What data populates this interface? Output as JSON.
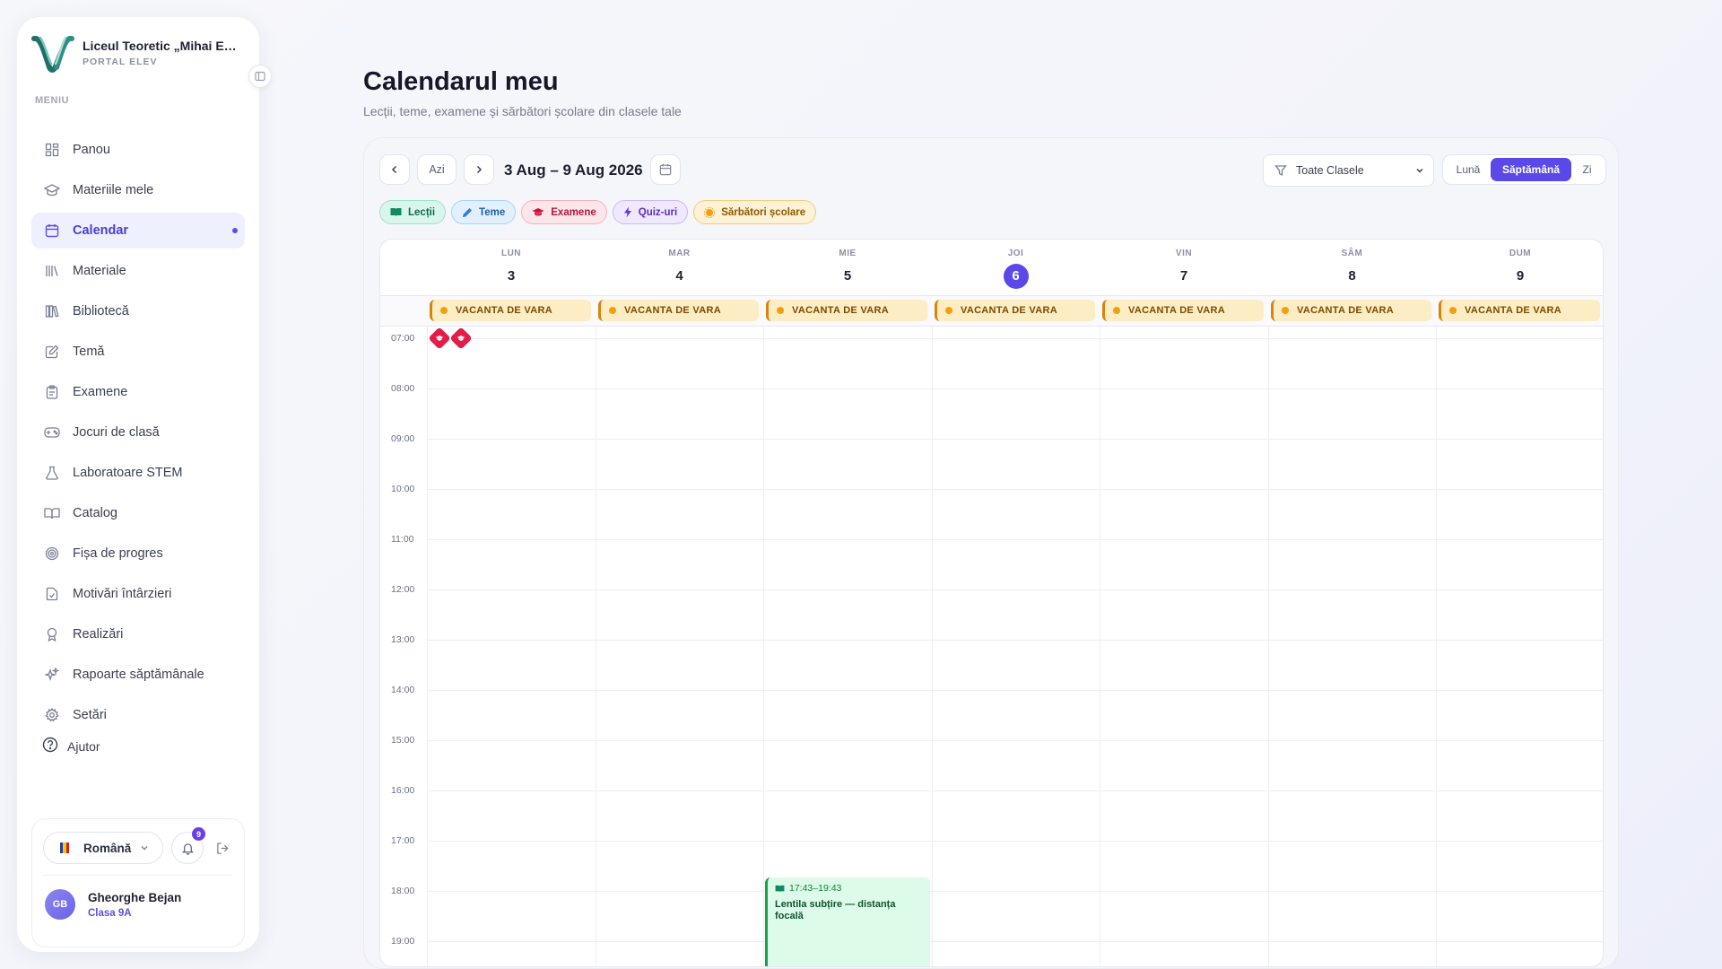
{
  "brand": {
    "name": "Liceul Teoretic „Mihai Emi…",
    "subtitle": "PORTAL ELEV"
  },
  "sidebar": {
    "menu_label": "MENIU",
    "items": [
      {
        "label": "Panou",
        "icon": "grid-icon"
      },
      {
        "label": "Materiile mele",
        "icon": "graduation-cap-icon"
      },
      {
        "label": "Calendar",
        "icon": "calendar-icon",
        "active": true
      },
      {
        "label": "Materiale",
        "icon": "library-icon"
      },
      {
        "label": "Bibliotecă",
        "icon": "books-icon"
      },
      {
        "label": "Temă",
        "icon": "edit-icon"
      },
      {
        "label": "Examene",
        "icon": "clipboard-icon"
      },
      {
        "label": "Jocuri de clasă",
        "icon": "gamepad-icon"
      },
      {
        "label": "Laboratoare STEM",
        "icon": "flask-icon"
      },
      {
        "label": "Catalog",
        "icon": "book-open-icon"
      },
      {
        "label": "Fișa de progres",
        "icon": "target-icon"
      },
      {
        "label": "Motivări întârzieri",
        "icon": "file-check-icon"
      },
      {
        "label": "Realizări",
        "icon": "award-icon"
      },
      {
        "label": "Rapoarte săptămânale",
        "icon": "sparkles-icon"
      },
      {
        "label": "Setări",
        "icon": "gear-icon"
      }
    ],
    "help_label": "Ajutor"
  },
  "footer": {
    "language": "Română",
    "notifications_count": "9",
    "user": {
      "initials": "GB",
      "name": "Gheorghe Bejan",
      "class": "Clasa 9A"
    }
  },
  "page": {
    "title": "Calendarul meu",
    "subtitle": "Lecții, teme, examene și sărbători școlare din clasele tale"
  },
  "toolbar": {
    "today_label": "Azi",
    "range": "3 Aug – 9 Aug 2026",
    "class_filter": "Toate Clasele",
    "views": {
      "month": "Lună",
      "week": "Săptămână",
      "day": "Zi"
    },
    "active_view": "week"
  },
  "legend": [
    {
      "key": "lectii",
      "label": "Lecții"
    },
    {
      "key": "teme",
      "label": "Teme"
    },
    {
      "key": "examene",
      "label": "Examene"
    },
    {
      "key": "quiz",
      "label": "Quiz-uri"
    },
    {
      "key": "sarb",
      "label": "Sărbători școlare"
    }
  ],
  "calendar": {
    "days": [
      {
        "name": "LUN",
        "num": "3"
      },
      {
        "name": "MAR",
        "num": "4"
      },
      {
        "name": "MIE",
        "num": "5"
      },
      {
        "name": "JOI",
        "num": "6",
        "today": true
      },
      {
        "name": "VIN",
        "num": "7"
      },
      {
        "name": "SÂM",
        "num": "8"
      },
      {
        "name": "DUM",
        "num": "9"
      }
    ],
    "all_day_label": "VACANTA DE VARA",
    "hours": [
      "07:00",
      "08:00",
      "09:00",
      "10:00",
      "11:00",
      "12:00",
      "13:00",
      "14:00",
      "15:00",
      "16:00",
      "17:00",
      "18:00",
      "19:00"
    ],
    "event": {
      "time": "17:43–19:43",
      "title": "Lentila subțire — distanța focală"
    },
    "colors": {
      "accent": "#5a49e8",
      "exam": "#e11d48",
      "lesson": "#16a34a",
      "holiday": "#f59e0b"
    }
  }
}
